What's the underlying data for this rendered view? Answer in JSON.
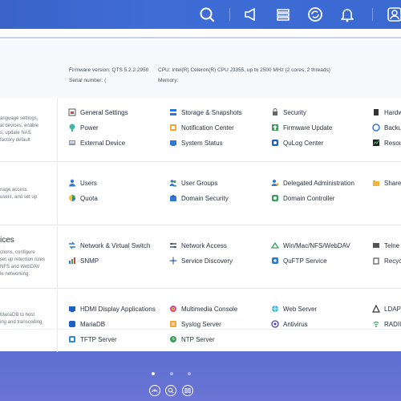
{
  "sysinfo": {
    "firmware": "Firmware version:  QTS 5.2.2.2950",
    "serial": "Serial number:  (",
    "cpu": "CPU:  Intel(R) Celeron(R) CPU J3355, up to 2500 MHz (2 cores, 2 threads)",
    "memory": "Memory:"
  },
  "sections": {
    "system": {
      "desc": [
        "anguage settings,",
        "al devices, enable",
        "s, update NAS",
        " factory default"
      ],
      "items": {
        "general": "General Settings",
        "storage": "Storage & Snapshots",
        "security": "Security",
        "hardware": "Hardw",
        "power": "Power",
        "notification": "Notification Center",
        "firmware": "Firmware Update",
        "backup": "Backu",
        "external": "External Device",
        "status": "System Status",
        "qulog": "QuLog Center",
        "resource": "Resou"
      }
    },
    "privilege": {
      "desc": [
        "nage access",
        "users, and set up"
      ],
      "items": {
        "users": "Users",
        "groups": "User Groups",
        "delegated": "Delegated Administration",
        "shared": "Share",
        "quota": "Quota",
        "domain_security": "Domain Security",
        "domain_controller": "Domain Controller"
      }
    },
    "network": {
      "title": "ices",
      "desc": [
        "ctions, configure",
        "set up retention rules",
        "NFS and WebDAV",
        "le networking."
      ],
      "items": {
        "vswitch": "Network & Virtual Switch",
        "access": "Network Access",
        "winmac": "Win/Mac/NFS/WebDAV",
        "telnet": "Telne",
        "snmp": "SNMP",
        "discovery": "Service Discovery",
        "quftp": "QuFTP Service",
        "recycle": "Recyc"
      }
    },
    "apps": {
      "desc": [
        "MariaDB to host",
        "ing and transcoding"
      ],
      "items": {
        "hdmi": "HDMI Display Applications",
        "multimedia": "Multimedia Console",
        "webserver": "Web Server",
        "ldap": "LDAP",
        "mariadb": "MariaDB",
        "syslog": "Syslog Server",
        "antivirus": "Antivirus",
        "radius": "RADIU",
        "tftp": "TFTP Server",
        "ntp": "NTP Server"
      }
    }
  },
  "colors": {
    "taskbar": "#3b63c8",
    "desktop": "#5a6ed0",
    "accent_blue": "#2f78d6",
    "text": "#2a3142"
  }
}
